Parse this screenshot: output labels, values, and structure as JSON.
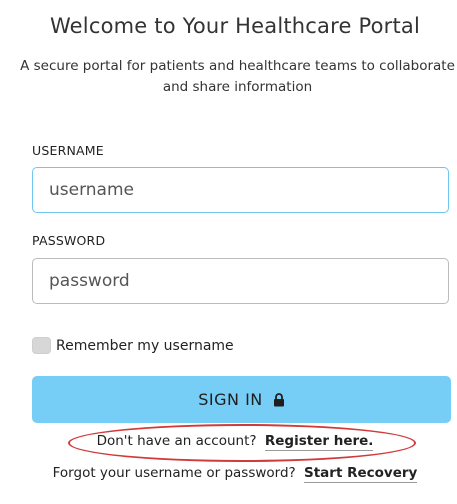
{
  "header": {
    "title": "Welcome to Your Healthcare Portal",
    "subtitle_line1": "A secure portal for patients and healthcare teams to collaborate",
    "subtitle_line2": "and share information"
  },
  "form": {
    "username_label": "USERNAME",
    "username_placeholder": "username",
    "username_value": "",
    "password_label": "PASSWORD",
    "password_placeholder": "password",
    "password_value": "",
    "remember_label": "Remember my username",
    "remember_checked": false,
    "signin_label": "SIGN IN",
    "signin_icon": "lock-icon"
  },
  "footer": {
    "register_prompt": "Don't have an account?",
    "register_link": "Register here.",
    "recovery_prompt": "Forgot your username or password?",
    "recovery_link": "Start Recovery"
  },
  "colors": {
    "signin_button": "#76cdf6",
    "focused_border": "#6ec6f1",
    "annotation_ellipse": "#d23a3a"
  }
}
